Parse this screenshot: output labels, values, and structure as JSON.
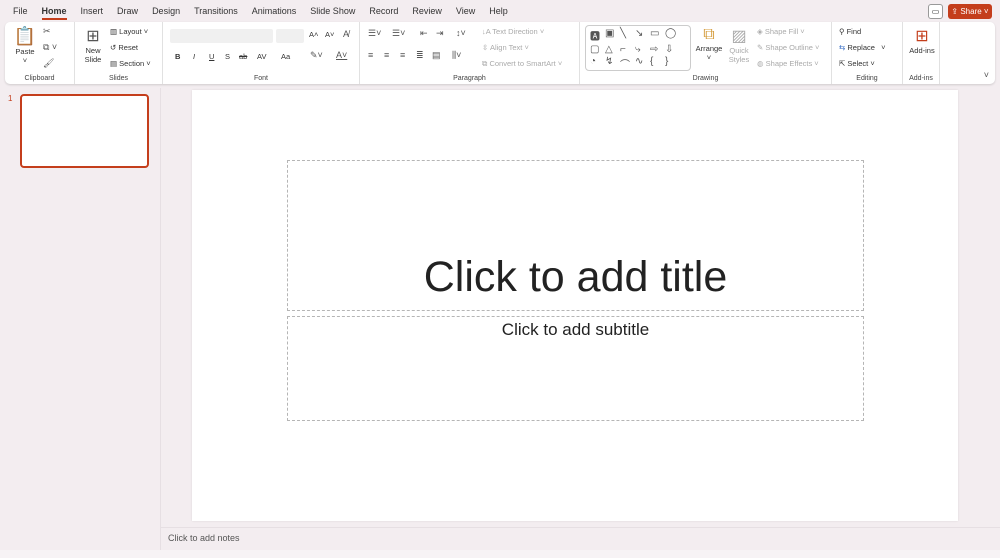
{
  "tabs": [
    "File",
    "Home",
    "Insert",
    "Draw",
    "Design",
    "Transitions",
    "Animations",
    "Slide Show",
    "Record",
    "Review",
    "View",
    "Help"
  ],
  "active_tab": "Home",
  "share_label": "Share",
  "clipboard": {
    "paste": "Paste",
    "label": "Clipboard"
  },
  "slides_group": {
    "new_slide_1": "New",
    "new_slide_2": "Slide",
    "layout": "Layout",
    "reset": "Reset",
    "section": "Section",
    "label": "Slides"
  },
  "font": {
    "label": "Font",
    "bold": "B",
    "italic": "I",
    "underline": "U",
    "shadow": "S",
    "strike": "ab",
    "spacing": "AV",
    "case": "Aa",
    "grow": "A˄",
    "shrink": "A˅"
  },
  "paragraph": {
    "label": "Paragraph",
    "text_direction": "Text Direction",
    "align_text": "Align Text",
    "convert": "Convert to SmartArt"
  },
  "drawing": {
    "label": "Drawing",
    "arrange": "Arrange",
    "quick_1": "Quick",
    "quick_2": "Styles",
    "fill": "Shape Fill",
    "outline": "Shape Outline",
    "effects": "Shape Effects"
  },
  "editing": {
    "label": "Editing",
    "find": "Find",
    "replace": "Replace",
    "select": "Select"
  },
  "addins": {
    "label": "Add-ins",
    "button": "Add-ins"
  },
  "slide_number": "1",
  "slide": {
    "title": "Click to add title",
    "subtitle": "Click to add subtitle"
  },
  "notes": "Click to add notes",
  "colors": {
    "accent": "#c43e1c"
  }
}
